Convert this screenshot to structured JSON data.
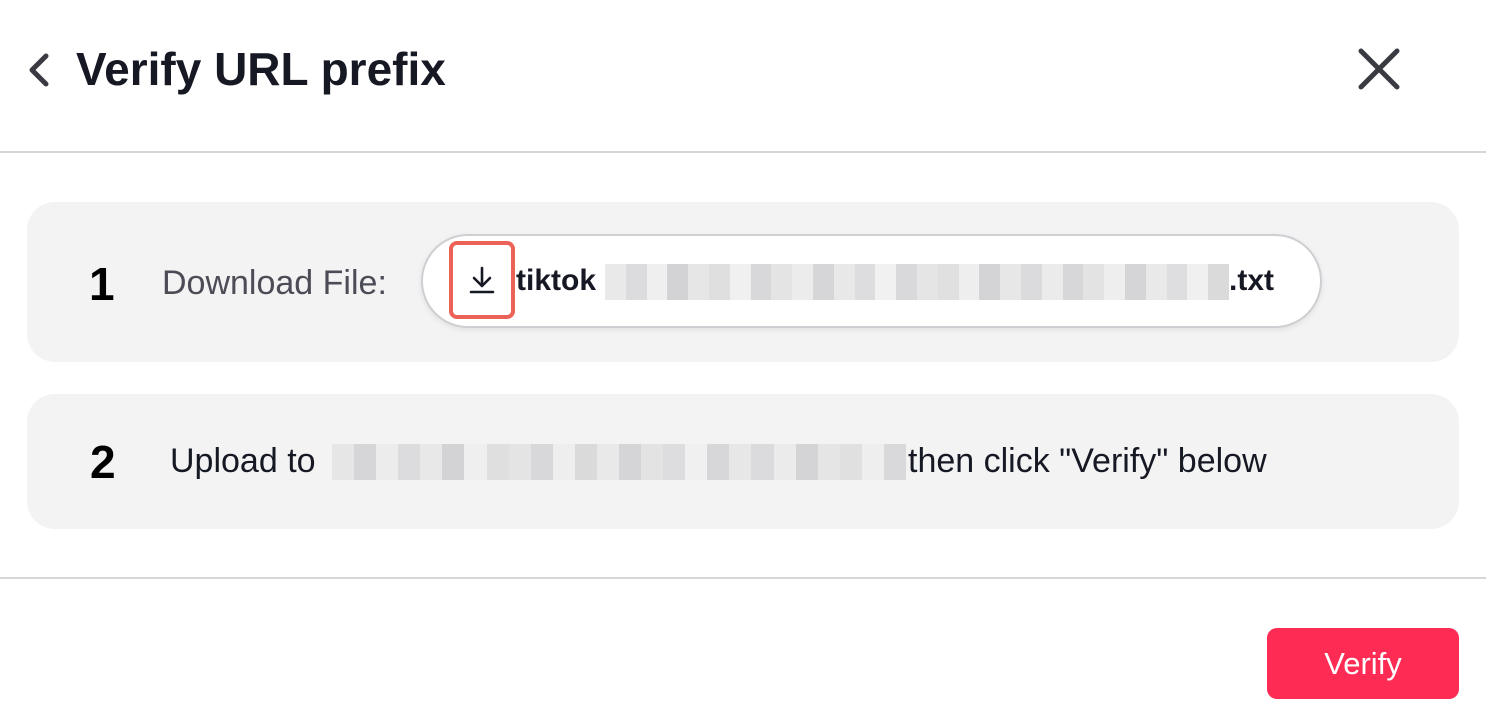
{
  "header": {
    "title": "Verify URL prefix",
    "back_icon": "chevron-left-icon",
    "close_icon": "close-icon"
  },
  "steps": [
    {
      "number": "1",
      "label": "Download File:",
      "file_name_prefix": "tiktok",
      "file_name_suffix": ".txt",
      "file_name_redacted": true,
      "download_icon": "download-icon"
    },
    {
      "number": "2",
      "text_before": "Upload to",
      "url_redacted": true,
      "text_after": "then click \"Verify\" below"
    }
  ],
  "footer": {
    "verify_label": "Verify"
  },
  "colors": {
    "accent": "#fe2c55",
    "highlight_border": "#ec6256",
    "card_background": "#f3f3f4",
    "divider": "#d6d6d9",
    "text_primary": "#161823",
    "text_secondary": "#4b4c55"
  }
}
